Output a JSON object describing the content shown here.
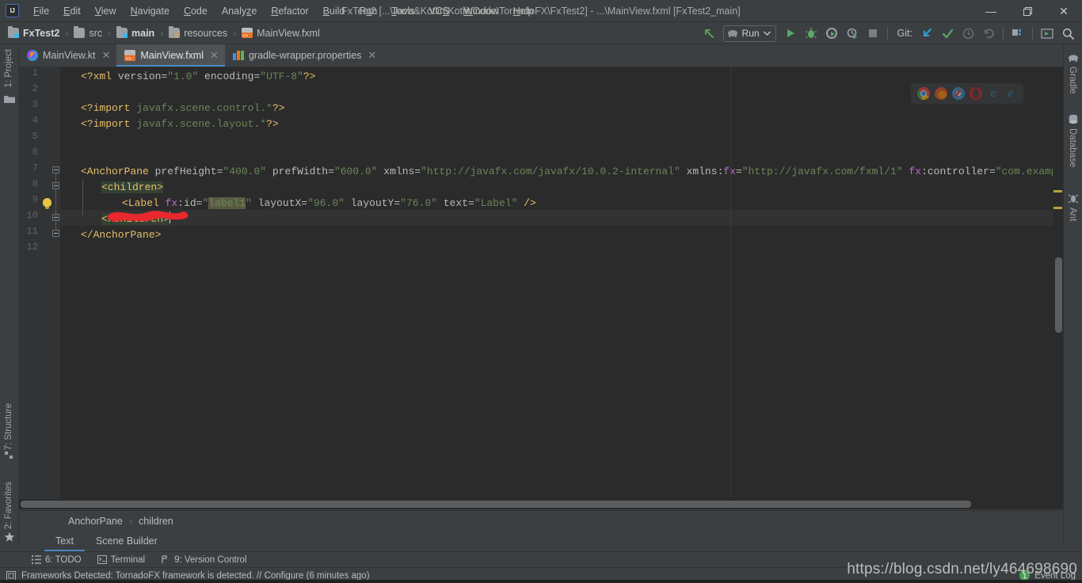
{
  "window": {
    "title": "FxTest2 [...\\Java&Kotlin\\KotlinCode\\TornadoFX\\FxTest2] - ...\\MainView.fxml [FxTest2_main]",
    "logo": "IJ",
    "minimize": "—",
    "restore": "❐",
    "close": "✕"
  },
  "menubar": {
    "items": [
      {
        "label": "File",
        "mnemonic": "F"
      },
      {
        "label": "Edit",
        "mnemonic": "E"
      },
      {
        "label": "View",
        "mnemonic": "V"
      },
      {
        "label": "Navigate",
        "mnemonic": "N"
      },
      {
        "label": "Code",
        "mnemonic": "C"
      },
      {
        "label": "Analyze",
        "mnemonic": "z"
      },
      {
        "label": "Refactor",
        "mnemonic": "R"
      },
      {
        "label": "Build",
        "mnemonic": "B"
      },
      {
        "label": "Run",
        "mnemonic": "u"
      },
      {
        "label": "Tools",
        "mnemonic": "T"
      },
      {
        "label": "VCS",
        "mnemonic": "S"
      },
      {
        "label": "Window",
        "mnemonic": "W"
      },
      {
        "label": "Help",
        "mnemonic": "H"
      }
    ]
  },
  "breadcrumbs": {
    "items": [
      {
        "label": "FxTest2",
        "icon": "module-icon",
        "bold": true
      },
      {
        "label": "src",
        "icon": "folder-icon",
        "bold": false
      },
      {
        "label": "main",
        "icon": "module-icon",
        "bold": true
      },
      {
        "label": "resources",
        "icon": "resources-folder-icon",
        "bold": false
      },
      {
        "label": "MainView.fxml",
        "icon": "fxml-file-icon",
        "bold": false
      }
    ],
    "separator": "›"
  },
  "toolbar": {
    "back_label": "back-arrow",
    "run_config": "Run",
    "git_label": "Git:",
    "buttons": [
      "run-button",
      "debug-button",
      "run-coverage-button",
      "profiler-button",
      "stop-button",
      "update-project-button",
      "commit-button",
      "history-button",
      "rollback-button",
      "project-structure-button",
      "preview-button",
      "search-everywhere-button"
    ]
  },
  "left_stripe": {
    "items": [
      {
        "label": "1: Project",
        "mnemonic": "1"
      },
      {
        "label": "7: Structure",
        "mnemonic": "7"
      },
      {
        "label": "2: Favorites",
        "mnemonic": "2"
      }
    ]
  },
  "right_stripe": {
    "items": [
      {
        "label": "Gradle"
      },
      {
        "label": "Database"
      },
      {
        "label": "Ant"
      }
    ]
  },
  "editor_tabs": {
    "close_glyph": "✕",
    "items": [
      {
        "label": "MainView.kt",
        "icon": "kotlin-file-icon",
        "active": false
      },
      {
        "label": "MainView.fxml",
        "icon": "fxml-file-icon",
        "active": true
      },
      {
        "label": "gradle-wrapper.properties",
        "icon": "properties-file-icon",
        "active": false
      }
    ]
  },
  "editor": {
    "line_numbers": [
      "1",
      "2",
      "3",
      "4",
      "5",
      "6",
      "7",
      "8",
      "9",
      "10",
      "11",
      "12"
    ],
    "lines": [
      {
        "n": 1,
        "text": "<?xml version=\"1.0\" encoding=\"UTF-8\"?>"
      },
      {
        "n": 2,
        "text": ""
      },
      {
        "n": 3,
        "text": "<?import javafx.scene.control.*?>"
      },
      {
        "n": 4,
        "text": "<?import javafx.scene.layout.*?>"
      },
      {
        "n": 5,
        "text": ""
      },
      {
        "n": 6,
        "text": ""
      },
      {
        "n": 7,
        "text": "<AnchorPane prefHeight=\"400.0\" prefWidth=\"600.0\" xmlns=\"http://javafx.com/javafx/10.0.2-internal\" xmlns:fx=\"http://javafx.com/fxml/1\" fx:controller=\"com.example.demo.view.MainView\">"
      },
      {
        "n": 8,
        "text": "   <children>"
      },
      {
        "n": 9,
        "text": "      <Label fx:id=\"label1\" layoutX=\"96.0\" layoutY=\"76.0\" text=\"Label\" />"
      },
      {
        "n": 10,
        "text": "   </children>"
      },
      {
        "n": 11,
        "text": "</AnchorPane>"
      },
      {
        "n": 12,
        "text": ""
      }
    ],
    "browser_preview_icons": [
      "chrome-icon",
      "firefox-icon",
      "safari-icon",
      "opera-icon",
      "edge-icon",
      "internet-explorer-icon"
    ],
    "caret_line": 10
  },
  "editor_breadcrumb": {
    "items": [
      "AnchorPane",
      "children"
    ],
    "separator": "›"
  },
  "designer_tabs": {
    "items": [
      {
        "label": "Text",
        "active": true
      },
      {
        "label": "Scene Builder",
        "active": false
      }
    ]
  },
  "bottom_toolwindows": {
    "items": [
      {
        "label": "6: TODO",
        "mnemonic": "6",
        "icon": "todo-icon"
      },
      {
        "label": "Terminal",
        "mnemonic": "",
        "icon": "terminal-icon"
      },
      {
        "label": "9: Version Control",
        "mnemonic": "9",
        "icon": "vcs-icon"
      }
    ]
  },
  "statusbar": {
    "message": "Frameworks Detected: TornadoFX framework is detected. // Configure (6 minutes ago)",
    "message_icon": "notification-icon",
    "event_log": "Event Log",
    "event_count": "1"
  },
  "annotation": {
    "type": "red-underline-scribble",
    "target": "label1",
    "color": "#e8282d"
  },
  "watermark": {
    "text": "https://blog.csdn.net/ly464698690"
  },
  "colors": {
    "accent": "#4a88c7",
    "chrome_bg": "#3c3f41",
    "editor_bg": "#2b2b2b",
    "string": "#6a8759",
    "tag": "#e8bf6a",
    "attr_ns": "#bf6ad0",
    "annotation_red": "#e8282d",
    "run_green": "#62b543"
  }
}
